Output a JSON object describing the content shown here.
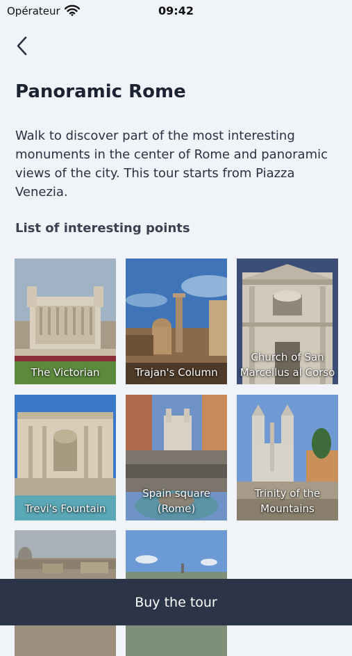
{
  "status_bar": {
    "carrier": "Opérateur",
    "time": "09:42"
  },
  "header": {
    "back_icon": "chevron-left-icon"
  },
  "tour": {
    "title": "Panoramic Rome",
    "description": "Walk to discover part of the most interesting monuments in the center of Rome and panoramic views of the city. This tour starts from Piazza Venezia.",
    "points_heading": "List of interesting points"
  },
  "points": [
    {
      "label": "The Victorian"
    },
    {
      "label": "Trajan's Column"
    },
    {
      "label": "Church of San Marcellus al Corso"
    },
    {
      "label": "Trevi's Fountain"
    },
    {
      "label": "Spain square (Rome)"
    },
    {
      "label": "Trinity of the Mountains"
    },
    {
      "label": ""
    },
    {
      "label": ""
    }
  ],
  "footer": {
    "buy_label": "Buy the tour"
  },
  "colors": {
    "background": "#f0f3f7",
    "footer": "#2c3548",
    "text": "#1e2535"
  }
}
